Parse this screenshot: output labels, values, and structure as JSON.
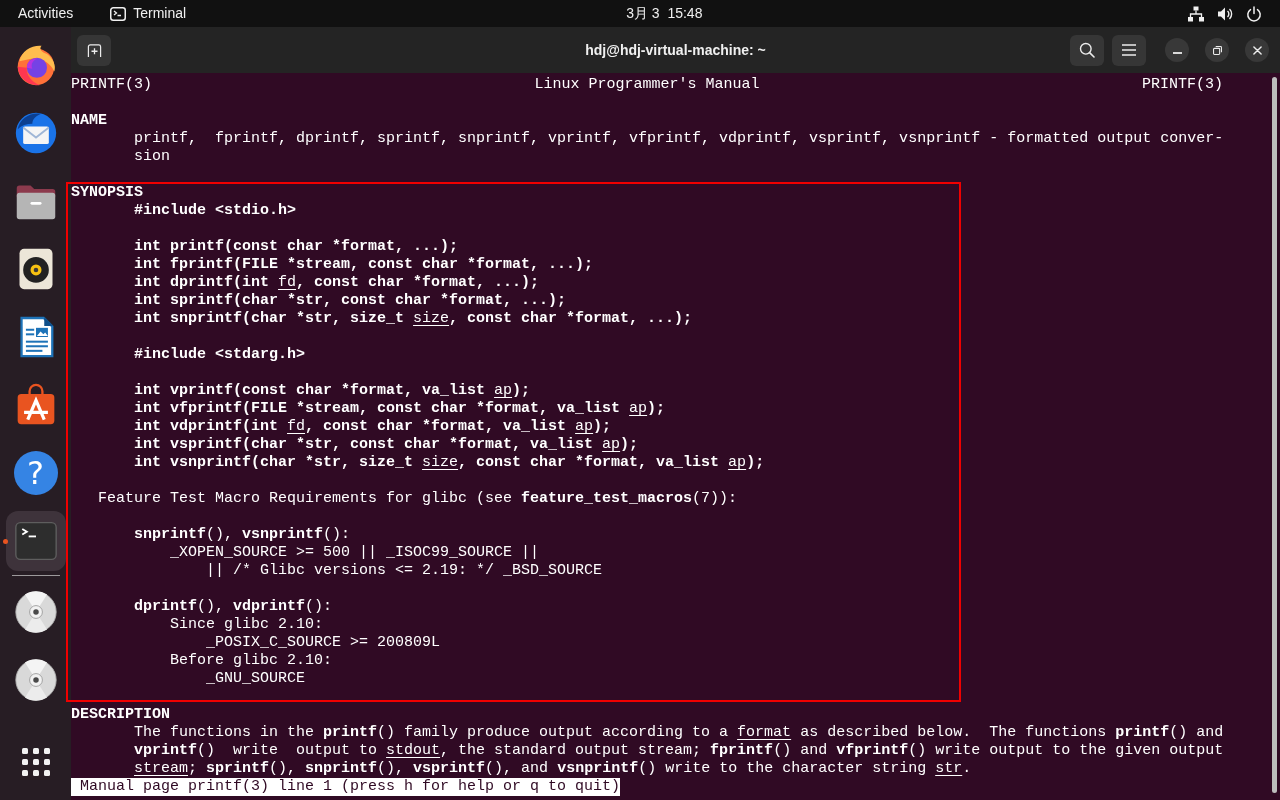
{
  "top_bar": {
    "activities": "Activities",
    "app_menu": "Terminal",
    "clock": "3月 3  15:48"
  },
  "dock": {
    "items": [
      {
        "kind": "browser",
        "selected": false,
        "running": false
      },
      {
        "kind": "mail",
        "selected": false,
        "running": false
      },
      {
        "kind": "files",
        "selected": false,
        "running": false
      },
      {
        "kind": "music",
        "selected": false,
        "running": false
      },
      {
        "kind": "writer",
        "selected": false,
        "running": false
      },
      {
        "kind": "store",
        "selected": false,
        "running": false
      },
      {
        "kind": "help",
        "glyph": "?",
        "selected": false,
        "running": false
      },
      {
        "kind": "terminal",
        "selected": true,
        "running": true
      }
    ],
    "devices": [
      {
        "kind": "disc",
        "selected": false
      },
      {
        "kind": "disc",
        "selected": false
      }
    ]
  },
  "terminal": {
    "title": "hdj@hdj-virtual-machine: ~",
    "man_page": {
      "header": {
        "left": "PRINTF(3)",
        "center": "Linux Programmer's Manual",
        "right": "PRINTF(3)"
      },
      "sections": [
        {
          "heading": "NAME",
          "blocks": [
            {
              "lines": [
                {
                  "kind": "text",
                  "text": "printf,  fprintf, dprintf, sprintf, snprintf, vprintf, vfprintf, vdprintf, vsprintf, vsnprintf - formatted output conver-"
                },
                {
                  "kind": "text",
                  "text": "sion"
                }
              ]
            }
          ]
        },
        {
          "heading": "SYNOPSIS",
          "blocks": [
            {
              "lines": [
                {
                  "kind": "code",
                  "text": "#include <stdio.h>"
                }
              ]
            },
            {
              "lines": [
                {
                  "kind": "code",
                  "text": "int printf(const char *format, ...);"
                },
                {
                  "kind": "code",
                  "text": "int fprintf(FILE *stream, const char *format, ...);"
                },
                {
                  "kind": "code",
                  "text": "int dprintf(int *fd*, const char *format, ...);"
                },
                {
                  "kind": "code",
                  "text": "int sprintf(char *str, const char *format, ...);"
                },
                {
                  "kind": "code",
                  "text": "int snprintf(char *str, size_t *size*, const char *format, ...);"
                }
              ]
            },
            {
              "lines": [
                {
                  "kind": "code",
                  "text": "#include <stdarg.h>"
                }
              ]
            },
            {
              "lines": [
                {
                  "kind": "code",
                  "text": "int vprintf(const char *format, va_list *ap*);"
                },
                {
                  "kind": "code",
                  "text": "int vfprintf(FILE *stream, const char *format, va_list *ap*);"
                },
                {
                  "kind": "code",
                  "text": "int vdprintf(int *fd*, const char *format, va_list *ap*);"
                },
                {
                  "kind": "code",
                  "text": "int vsprintf(char *str, const char *format, va_list *ap*);"
                },
                {
                  "kind": "code",
                  "text": "int vsnprintf(char *str, size_t *size*, const char *format, va_list *ap*);"
                }
              ]
            }
          ],
          "subsections": [
            {
              "heading": "Feature Test Macro Requirements for glibc (see **feature_test_macros**(7)):",
              "blocks": [
                {
                  "lines": [
                    {
                      "kind": "text",
                      "text": "**snprintf**(), **vsnprintf**():",
                      "children": [
                        {
                          "kind": "text",
                          "text": "_XOPEN_SOURCE >= 500 || _ISOC99_SOURCE ||",
                          "children": [
                            {
                              "kind": "text",
                              "text": "|| /* Glibc versions <= 2.19: */ _BSD_SOURCE"
                            }
                          ]
                        }
                      ]
                    }
                  ]
                },
                {
                  "lines": [
                    {
                      "kind": "text",
                      "text": "**dprintf**(), **vdprintf**():",
                      "children": [
                        {
                          "kind": "text",
                          "text": "Since glibc 2.10:",
                          "children": [
                            {
                              "kind": "text",
                              "text": "_POSIX_C_SOURCE >= 200809L"
                            }
                          ]
                        },
                        {
                          "kind": "text",
                          "text": "Before glibc 2.10:",
                          "children": [
                            {
                              "kind": "text",
                              "text": "_GNU_SOURCE"
                            }
                          ]
                        }
                      ]
                    }
                  ]
                }
              ]
            }
          ]
        },
        {
          "heading": "DESCRIPTION",
          "blocks": [
            {
              "lines": [
                {
                  "kind": "text",
                  "text": "The functions in the **printf**() family produce output according to a *format* as described below.  The functions **printf**() and"
                },
                {
                  "kind": "text",
                  "text": "**vprintf**()  write  output to *stdout*, the standard output stream; **fprintf**() and **vfprintf**() write output to the given output"
                },
                {
                  "kind": "text",
                  "text": "*stream*; **sprintf**(), **snprintf**(), **vsprintf**(), and **vsnprintf**() write to the character string *str*."
                }
              ]
            }
          ]
        }
      ],
      "status_line": "Manual page printf(3) line 1 (press h for help or q to quit)"
    }
  }
}
